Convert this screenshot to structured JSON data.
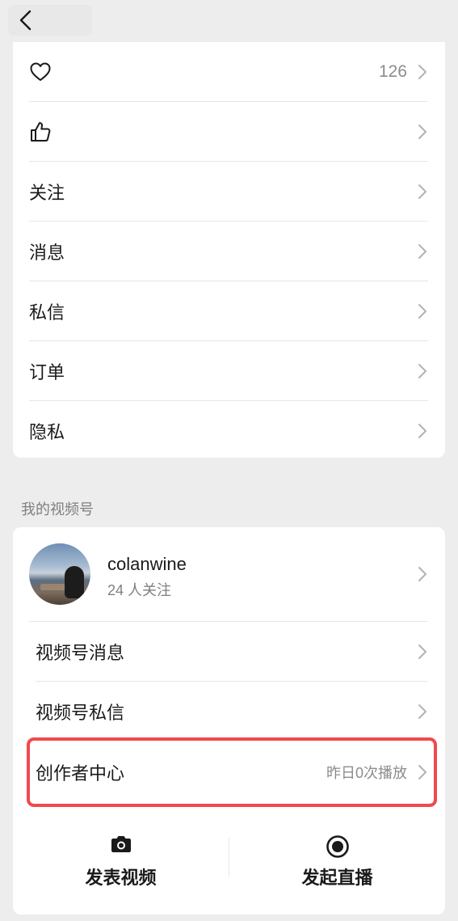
{
  "nav": {
    "back_icon": "chevron-left-icon"
  },
  "menu": [
    {
      "icon": "heart-icon",
      "label": "",
      "value": "126"
    },
    {
      "icon": "thumbs-up-icon",
      "label": "",
      "value": ""
    },
    {
      "icon": "",
      "label": "关注",
      "value": ""
    },
    {
      "icon": "",
      "label": "消息",
      "value": ""
    },
    {
      "icon": "",
      "label": "私信",
      "value": ""
    },
    {
      "icon": "",
      "label": "订单",
      "value": ""
    },
    {
      "icon": "",
      "label": "隐私",
      "value": ""
    }
  ],
  "channels": {
    "section_title": "我的视频号",
    "profile": {
      "username": "colanwine",
      "followers": "24 人关注"
    },
    "items": [
      {
        "label": "视频号消息",
        "value": ""
      },
      {
        "label": "视频号私信",
        "value": ""
      },
      {
        "label": "创作者中心",
        "value": "昨日0次播放"
      }
    ],
    "actions": [
      {
        "icon": "camera-icon",
        "label": "发表视频"
      },
      {
        "icon": "record-icon",
        "label": "发起直播"
      }
    ]
  },
  "colors": {
    "highlight": "#f04a4e",
    "background": "#ededed"
  }
}
